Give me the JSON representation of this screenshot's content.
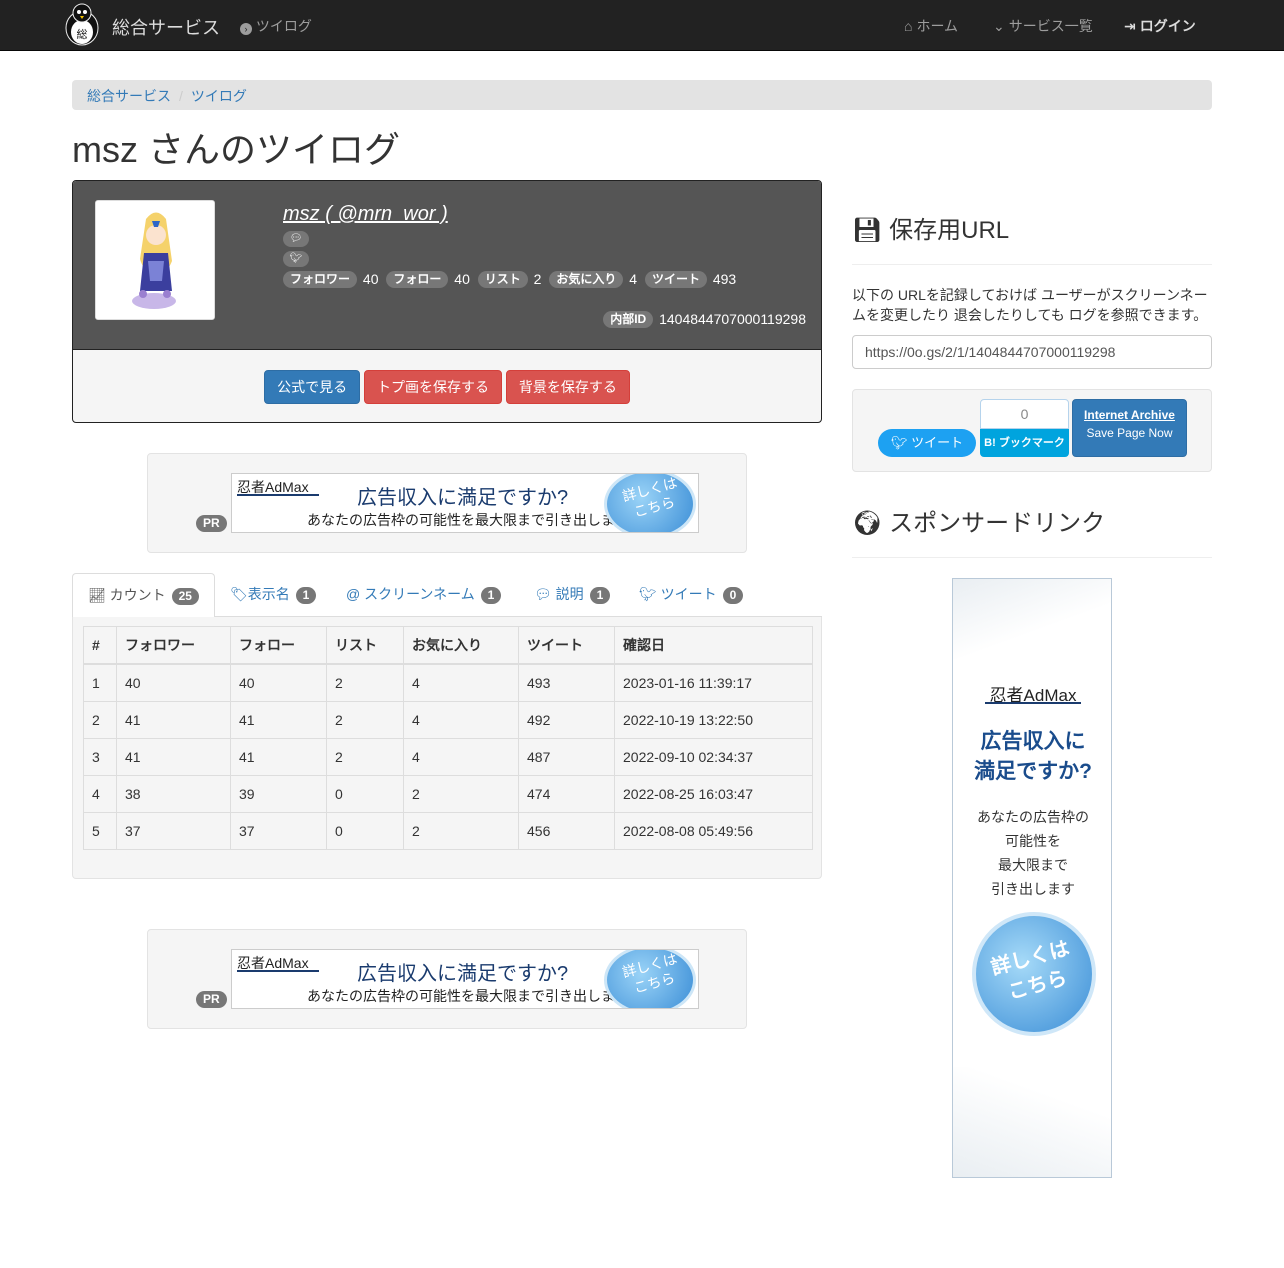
{
  "navbar": {
    "brand": "総合サービス",
    "twilog": "ツイログ",
    "home": "ホーム",
    "services": "サービス一覧",
    "login": "ログイン"
  },
  "breadcrumb": [
    "総合サービス",
    "ツイログ"
  ],
  "title": "msz さんのツイログ",
  "profile": {
    "name": "msz ( @mrn_wor )",
    "stats": [
      {
        "label": "フォロワー",
        "value": "40"
      },
      {
        "label": "フォロー",
        "value": "40"
      },
      {
        "label": "リスト",
        "value": "2"
      },
      {
        "label": "お気に入り",
        "value": "4"
      },
      {
        "label": "ツイート",
        "value": "493"
      }
    ],
    "internal_id_label": "内部ID",
    "internal_id": "1404844707000119298",
    "buttons": {
      "official": "公式で見る",
      "save_icon": "トプ画を保存する",
      "save_bg": "背景を保存する"
    }
  },
  "ads": {
    "pr": "PR",
    "brand": "忍者AdMax",
    "headline": "広告収入に満足ですか?",
    "sub": "あなたの広告枠の可能性を最大限まで引き出します",
    "circle": "詳しくは\nこちら",
    "side_headline": "広告収入に\n満足ですか?",
    "side_body": "あなたの広告枠の\n可能性を\n最大限まで\n引き出します"
  },
  "tabs": [
    {
      "label": "カウント",
      "count": "25",
      "icon": "chart-line-icon"
    },
    {
      "label": "表示名",
      "count": "1",
      "icon": "tag-icon"
    },
    {
      "label": "スクリーンネーム",
      "count": "1",
      "icon": "at-icon"
    },
    {
      "label": "説明",
      "count": "1",
      "icon": "comment-icon"
    },
    {
      "label": "ツイート",
      "count": "0",
      "icon": "twitter-icon"
    }
  ],
  "table": {
    "headers": [
      "#",
      "フォロワー",
      "フォロー",
      "リスト",
      "お気に入り",
      "ツイート",
      "確認日"
    ],
    "rows": [
      [
        "1",
        "40",
        "40",
        "2",
        "4",
        "493",
        "2023-01-16 11:39:17"
      ],
      [
        "2",
        "41",
        "41",
        "2",
        "4",
        "492",
        "2022-10-19 13:22:50"
      ],
      [
        "3",
        "41",
        "41",
        "2",
        "4",
        "487",
        "2022-09-10 02:34:37"
      ],
      [
        "4",
        "38",
        "39",
        "0",
        "2",
        "474",
        "2022-08-25 16:03:47"
      ],
      [
        "5",
        "37",
        "37",
        "0",
        "2",
        "456",
        "2022-08-08 05:49:56"
      ]
    ]
  },
  "sidebar": {
    "save_heading": "保存用URL",
    "save_desc": "以下の URLを記録しておけば ユーザーがスクリーンネームを変更したり 退会したりしても ログを参照できます。",
    "save_url": "https://0o.gs/2/1/1404844707000119298",
    "tweet_button": "ツイート",
    "hatena_count": "0",
    "hatena_button": "B! ブックマーク",
    "archive_title": "Internet Archive",
    "archive_sub": "Save Page Now",
    "sponsor_heading": "スポンサードリンク"
  }
}
